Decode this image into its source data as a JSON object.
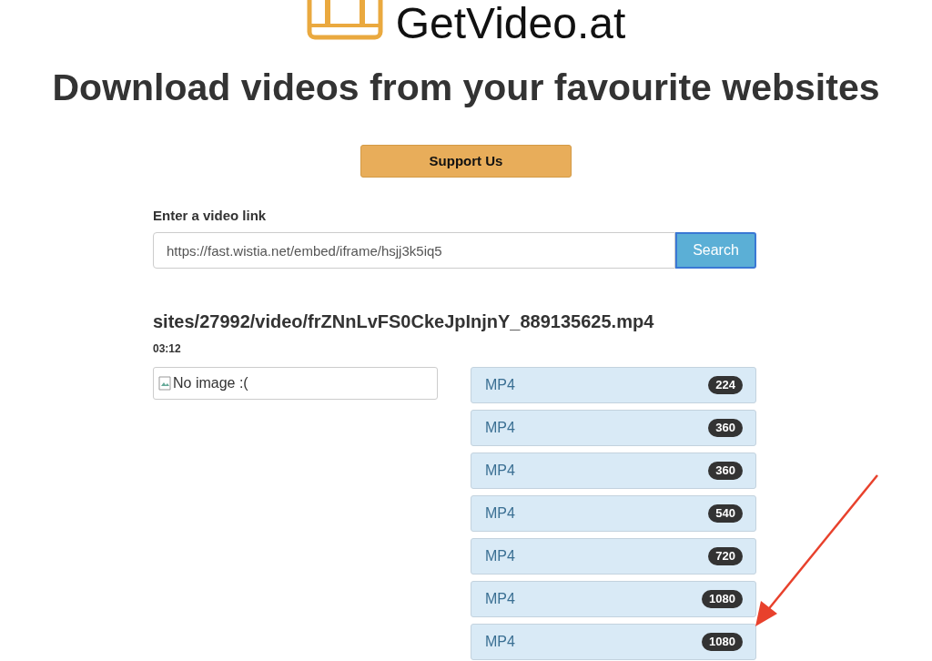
{
  "logo": {
    "text": "GetVideo.at"
  },
  "headline": "Download videos from your favourite websites",
  "support_button": "Support Us",
  "link_form": {
    "label": "Enter a video link",
    "value": "https://fast.wistia.net/embed/iframe/hsjj3k5iq5",
    "button": "Search"
  },
  "video": {
    "filename": "sites/27992/video/frZNnLvFS0CkeJpInjnY_889135625.mp4",
    "duration": "03:12",
    "image_alt": "No image :(",
    "formats": [
      {
        "format": "MP4",
        "quality": "224"
      },
      {
        "format": "MP4",
        "quality": "360"
      },
      {
        "format": "MP4",
        "quality": "360"
      },
      {
        "format": "MP4",
        "quality": "540"
      },
      {
        "format": "MP4",
        "quality": "720"
      },
      {
        "format": "MP4",
        "quality": "1080"
      },
      {
        "format": "MP4",
        "quality": "1080"
      }
    ]
  }
}
